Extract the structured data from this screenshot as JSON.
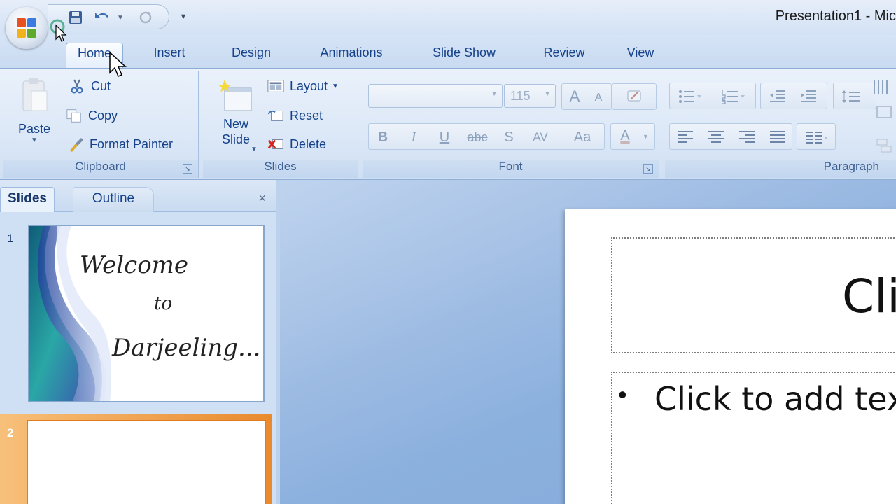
{
  "app": {
    "window_title": "Presentation1 - Mic"
  },
  "quick_access": {
    "save": "save-icon",
    "undo": "undo-icon",
    "redo": "redo-icon",
    "customize": "dropdown-arrow-icon"
  },
  "tabs": [
    "Home",
    "Insert",
    "Design",
    "Animations",
    "Slide Show",
    "Review",
    "View"
  ],
  "active_tab": "Home",
  "clipboard": {
    "paste": "Paste",
    "cut": "Cut",
    "copy": "Copy",
    "format_painter": "Format Painter",
    "label": "Clipboard"
  },
  "slides_group": {
    "new_slide_line1": "New",
    "new_slide_line2": "Slide",
    "layout": "Layout",
    "reset": "Reset",
    "delete": "Delete",
    "label": "Slides"
  },
  "font_group": {
    "font_name": "",
    "font_size": "115",
    "grow": "A",
    "shrink": "A",
    "bold": "B",
    "italic": "I",
    "underline": "U",
    "strikethrough": "abc",
    "shadow": "S",
    "char_spacing": "AV",
    "change_case": "Aa",
    "font_color": "A",
    "label": "Font"
  },
  "paragraph_group": {
    "label": "Paragraph"
  },
  "panel": {
    "tab_slides": "Slides",
    "tab_outline": "Outline",
    "close": "×"
  },
  "thumbnails": [
    {
      "number": "1",
      "line1": "Welcome",
      "line2": "to",
      "line3": "Darjeeling..."
    },
    {
      "number": "2"
    }
  ],
  "slide": {
    "title_placeholder": "Cli",
    "body_placeholder": "Click to add tex",
    "bullet": "•"
  },
  "colors": {
    "accent_orange": "#e98a2e",
    "ribbon_text": "#15428b",
    "canvas_blue": "#8bb0de"
  }
}
